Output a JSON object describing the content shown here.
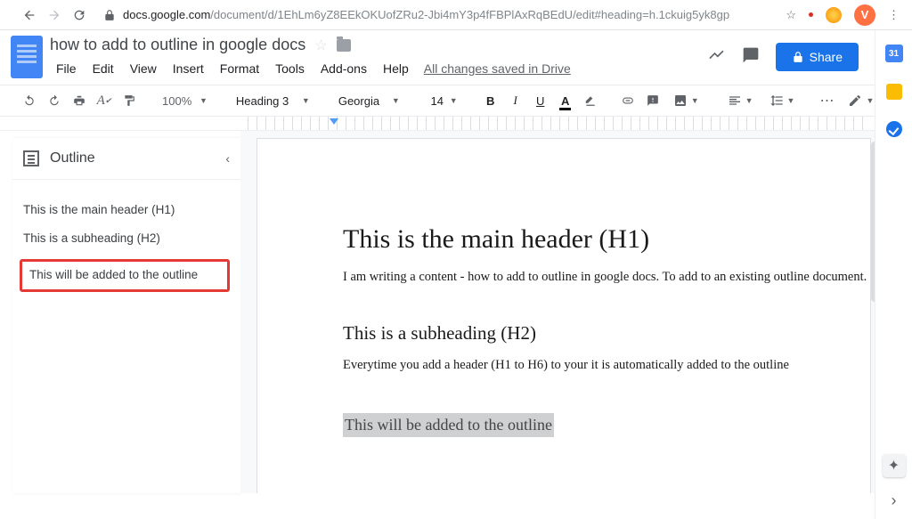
{
  "browser": {
    "url_host": "docs.google.com",
    "url_path": "/document/d/1EhLm6yZ8EEkOKUofZRu2-Jbi4mY3p4fFBPlAxRqBEdU/edit#heading=h.1ckuig5yk8gp"
  },
  "avatar_letter": "V",
  "doc": {
    "title": "how to add to outline in google docs",
    "menus": [
      "File",
      "Edit",
      "View",
      "Insert",
      "Format",
      "Tools",
      "Add-ons",
      "Help"
    ],
    "save_status": "All changes saved in Drive",
    "share_label": "Share"
  },
  "toolbar": {
    "zoom": "100%",
    "style": "Heading 3",
    "font": "Georgia",
    "font_size": "14"
  },
  "outline": {
    "title": "Outline",
    "items": [
      "This is the main header (H1)",
      "This is a subheading (H2)"
    ],
    "highlighted": "This will be added to the outline"
  },
  "page": {
    "h1": "This is the main header (H1)",
    "p1": "I am writing a content - how to add to outline in google docs. To add to an existing outline document.",
    "h2": "This is a subheading (H2)",
    "p2": "Everytime you add a header (H1 to H6) to your it is automatically added to the outline",
    "selected_h3": "This will be added to the outline"
  },
  "sidebar": {
    "calendar_day": "31"
  }
}
